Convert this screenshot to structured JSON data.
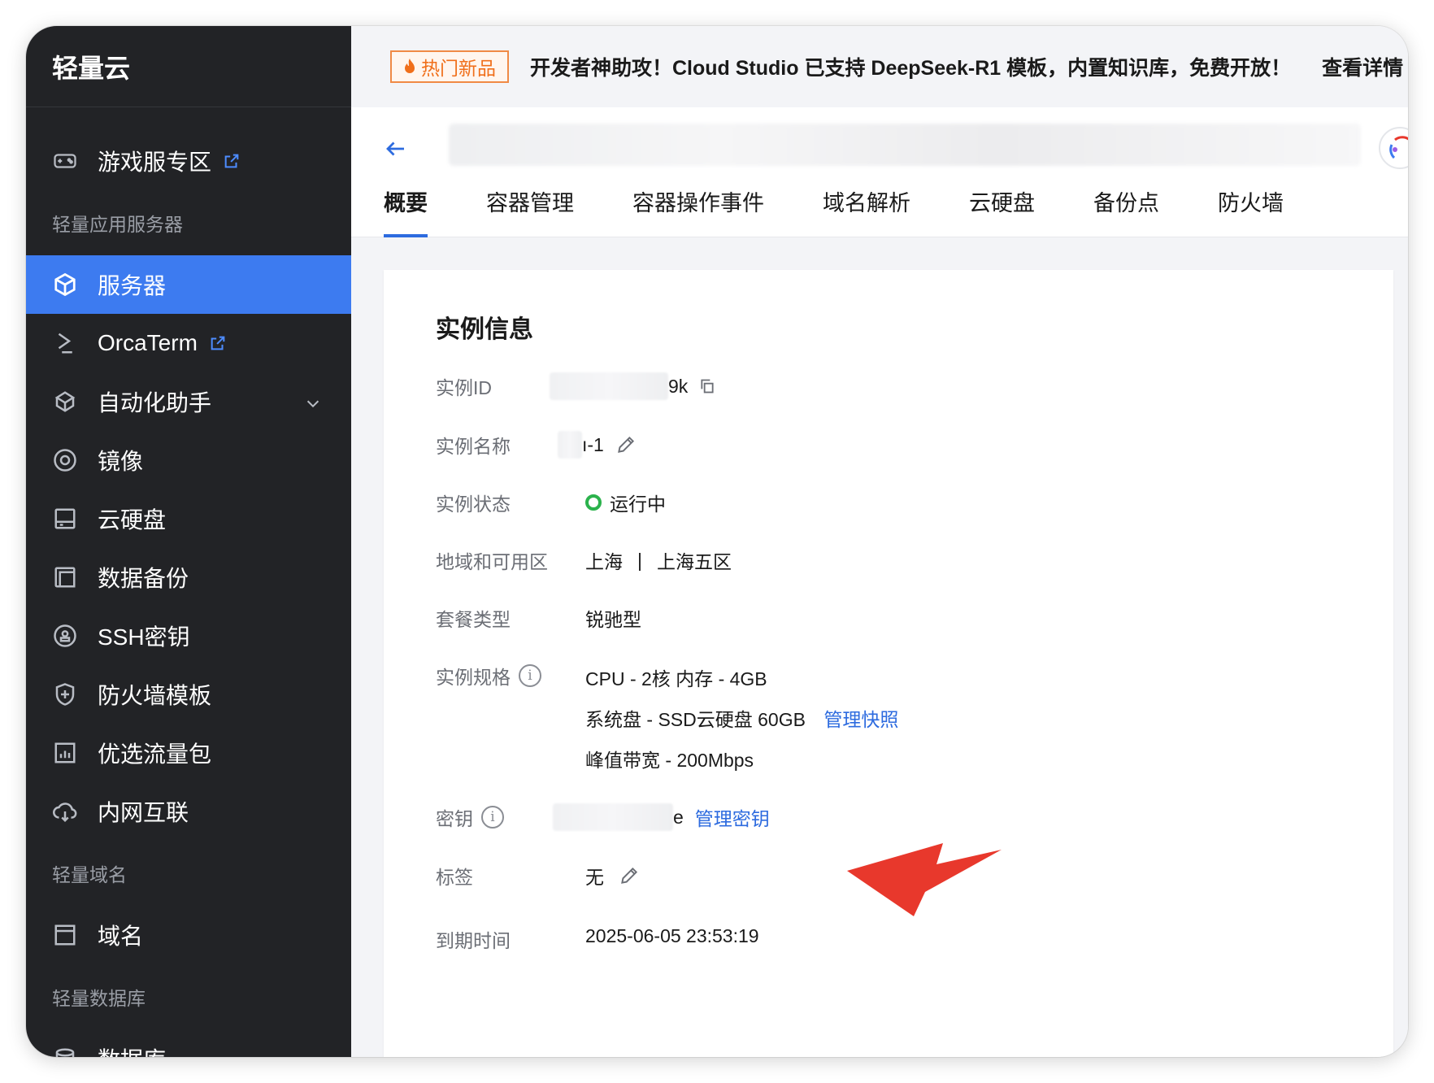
{
  "sidebar": {
    "brand": "轻量云",
    "items": [
      {
        "type": "item",
        "label": "游戏服专区",
        "icon": "gamepad-icon",
        "external": true
      },
      {
        "type": "group",
        "label": "轻量应用服务器"
      },
      {
        "type": "item",
        "label": "服务器",
        "icon": "cube-icon",
        "active": true
      },
      {
        "type": "item",
        "label": "OrcaTerm",
        "icon": "terminal-icon",
        "external": true
      },
      {
        "type": "item",
        "label": "自动化助手",
        "icon": "robot-icon",
        "expandable": true
      },
      {
        "type": "item",
        "label": "镜像",
        "icon": "disc-icon"
      },
      {
        "type": "item",
        "label": "云硬盘",
        "icon": "disk-icon"
      },
      {
        "type": "item",
        "label": "数据备份",
        "icon": "backup-icon"
      },
      {
        "type": "item",
        "label": "SSH密钥",
        "icon": "key-icon"
      },
      {
        "type": "item",
        "label": "防火墙模板",
        "icon": "shield-icon"
      },
      {
        "type": "item",
        "label": "优选流量包",
        "icon": "traffic-icon"
      },
      {
        "type": "item",
        "label": "内网互联",
        "icon": "network-icon"
      },
      {
        "type": "group",
        "label": "轻量域名"
      },
      {
        "type": "item",
        "label": "域名",
        "icon": "domain-icon"
      },
      {
        "type": "group",
        "label": "轻量数据库"
      },
      {
        "type": "item",
        "label": "数据库",
        "icon": "database-icon"
      }
    ]
  },
  "banner": {
    "badge": "热门新品",
    "text": "开发者神助攻！Cloud Studio 已支持 DeepSeek-R1 模板，内置知识库，免费开放！",
    "more": "查看详情"
  },
  "tabs": [
    "概要",
    "容器管理",
    "容器操作事件",
    "域名解析",
    "云硬盘",
    "备份点",
    "防火墙"
  ],
  "active_tab": "概要",
  "instance": {
    "title": "实例信息",
    "id_label": "实例ID",
    "id_value": "9k",
    "name_label": "实例名称",
    "name_value": "ı-1",
    "status_label": "实例状态",
    "status_value": "运行中",
    "region_label": "地域和可用区",
    "region_value": "上海",
    "region_sep": "|",
    "zone_value": "上海五区",
    "plan_label": "套餐类型",
    "plan_value": "锐驰型",
    "spec_label": "实例规格",
    "spec_cpu": "CPU - 2核 内存 - 4GB",
    "spec_disk": "系统盘 - SSD云硬盘 60GB",
    "spec_disk_link": "管理快照",
    "spec_bw": "峰值带宽 - 200Mbps",
    "key_label": "密钥",
    "key_value": "e",
    "key_link": "管理密钥",
    "tag_label": "标签",
    "tag_value": "无",
    "expire_label": "到期时间",
    "expire_value": "2025-06-05 23:53:19"
  },
  "colors": {
    "sidebar_bg": "#222326",
    "active_bg": "#3d7bf0",
    "link": "#2d6bdf",
    "status_ok": "#2bb24c",
    "annotation_arrow": "#e8382c",
    "badge": "#f06f1a"
  }
}
